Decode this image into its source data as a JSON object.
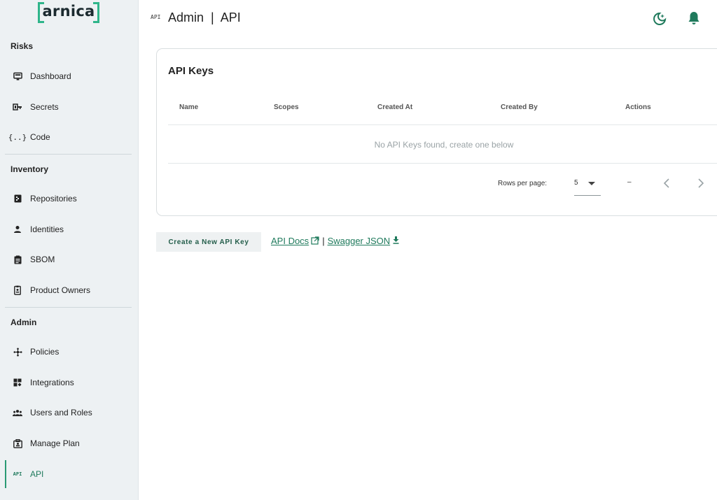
{
  "brand": {
    "logo_text": "arnica",
    "accent": "#2fb58a",
    "active_color": "#1f7a5c"
  },
  "sidebar": {
    "sections": [
      {
        "title": "Risks"
      },
      {
        "title": "Inventory"
      },
      {
        "title": "Admin"
      }
    ],
    "items": [
      {
        "label": "Dashboard",
        "icon": "monitor-icon"
      },
      {
        "label": "Secrets",
        "icon": "key-icon"
      },
      {
        "label": "Code",
        "icon": "code-braces-icon"
      },
      {
        "label": "Repositories",
        "icon": "repository-icon"
      },
      {
        "label": "Identities",
        "icon": "person-icon"
      },
      {
        "label": "SBOM",
        "icon": "clipboard-icon"
      },
      {
        "label": "Product Owners",
        "icon": "badge-icon"
      },
      {
        "label": "Policies",
        "icon": "policy-icon"
      },
      {
        "label": "Integrations",
        "icon": "grid-icon"
      },
      {
        "label": "Users and Roles",
        "icon": "group-icon"
      },
      {
        "label": "Manage Plan",
        "icon": "plan-icon"
      },
      {
        "label": "API",
        "icon": "api-icon",
        "icon_text": "API",
        "active": true
      }
    ]
  },
  "header": {
    "api_tag": "API",
    "title": "Admin  |  API",
    "theme_icon": "moon-star-icon",
    "notifications_icon": "bell-icon"
  },
  "api_keys": {
    "title": "API Keys",
    "columns": [
      "Name",
      "Scopes",
      "Created At",
      "Created By",
      "Actions"
    ],
    "empty_message": "No API Keys found, create one below",
    "pagination": {
      "rows_per_page_label": "Rows per page:",
      "rows_per_page_value": "5",
      "range_text": "–"
    }
  },
  "actions": {
    "create_label": "Create a New API Key",
    "api_docs_label": "API Docs",
    "separator": "|",
    "swagger_label": "Swagger JSON"
  }
}
